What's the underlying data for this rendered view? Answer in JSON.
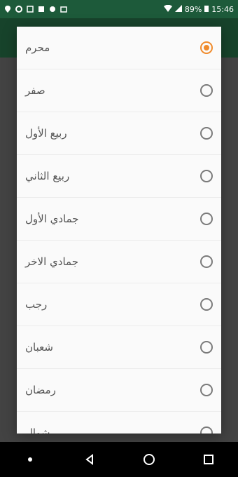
{
  "status_bar": {
    "battery": "89%",
    "time": "15:46"
  },
  "months": [
    {
      "label": "محرم",
      "selected": true
    },
    {
      "label": "صفر",
      "selected": false
    },
    {
      "label": "ربيع الأول",
      "selected": false
    },
    {
      "label": "ربيع الثاني",
      "selected": false
    },
    {
      "label": "جمادي الأول",
      "selected": false
    },
    {
      "label": "جمادي الاخر",
      "selected": false
    },
    {
      "label": "رجب",
      "selected": false
    },
    {
      "label": "شعبان",
      "selected": false
    },
    {
      "label": "رمضان",
      "selected": false
    },
    {
      "label": "شوال",
      "selected": false
    }
  ],
  "colors": {
    "accent": "#f08a2a",
    "status_bar": "#1d5a3a",
    "app_bar": "#2b7a4f"
  },
  "nav": {
    "icons": [
      "dot-icon",
      "back-icon",
      "home-icon",
      "recents-icon"
    ]
  }
}
